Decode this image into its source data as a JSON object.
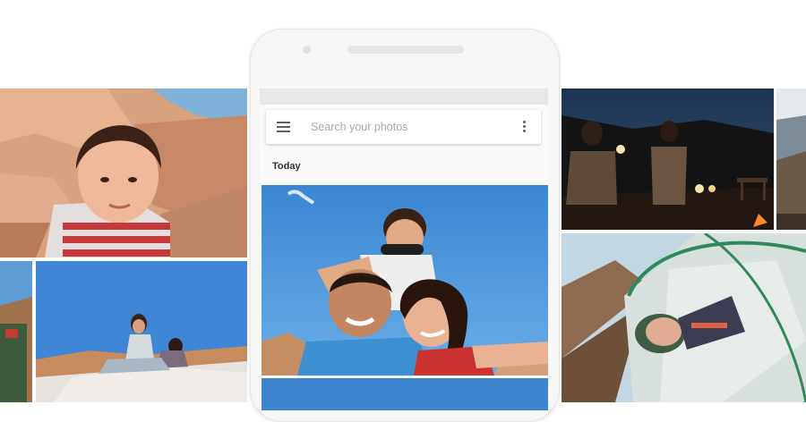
{
  "search": {
    "placeholder": "Search your photos"
  },
  "sections": [
    {
      "heading": "Today"
    }
  ],
  "icons": {
    "menu": "hamburger-menu-icon",
    "more": "vertical-more-icon"
  },
  "colors": {
    "background": "#ffffff",
    "phone_body": "#f7f7f7",
    "screen": "#fafafa",
    "search_text": "#a8a8a8",
    "sky_blue": "#3f8bd6"
  }
}
